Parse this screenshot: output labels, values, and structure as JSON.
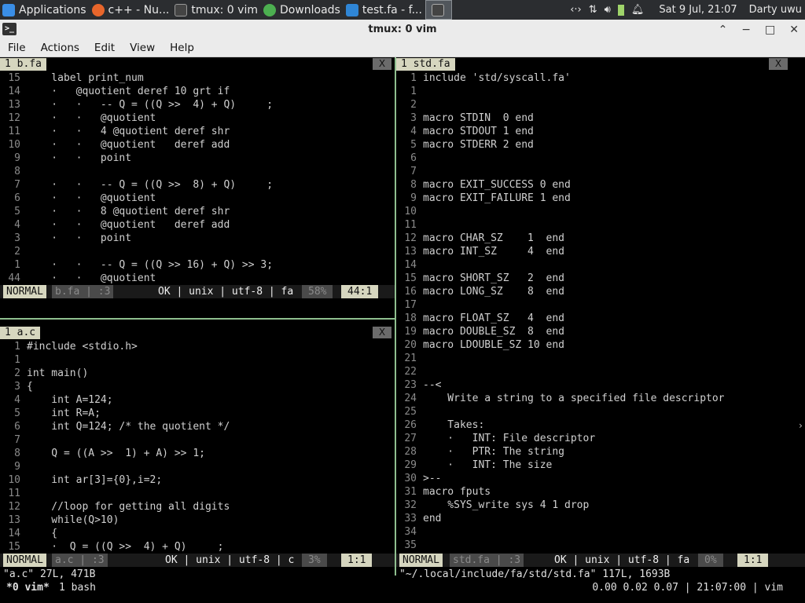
{
  "taskbar": {
    "items": [
      {
        "label": "Applications",
        "icon": "xfce-mouse-icon",
        "color": "#3a8ee6"
      },
      {
        "label": "c++ - Nu...",
        "icon": "firefox-icon",
        "color": "#e8662b"
      },
      {
        "label": "tmux: 0 vim",
        "icon": "terminal-icon",
        "color": "#444444"
      },
      {
        "label": "Downloads",
        "icon": "download-icon",
        "color": "#4caf50"
      },
      {
        "label": "test.fa - f...",
        "icon": "vscode-icon",
        "color": "#2f86d6"
      },
      {
        "label": "",
        "icon": "terminal-icon",
        "color": "#444444"
      }
    ],
    "tray": {
      "clock": "Sat  9 Jul, 21:07",
      "user": "Darty uwu"
    }
  },
  "window": {
    "title": "tmux: 0 vim",
    "icon": "terminal-icon"
  },
  "menu": [
    "File",
    "Actions",
    "Edit",
    "View",
    "Help"
  ],
  "panes": {
    "topleft": {
      "tab": "1  b.fa",
      "close": "X",
      "lines": [
        {
          "no": "15",
          "text": "    label print_num"
        },
        {
          "no": "14",
          "text": "    ·   @quotient deref 10 grt if"
        },
        {
          "no": "13",
          "text": "    ·   ·   -- Q = ((Q >>  4) + Q)     ;"
        },
        {
          "no": "12",
          "text": "    ·   ·   @quotient"
        },
        {
          "no": "11",
          "text": "    ·   ·   4 @quotient deref shr"
        },
        {
          "no": "10",
          "text": "    ·   ·   @quotient   deref add"
        },
        {
          "no": "9",
          "text": "    ·   ·   point"
        },
        {
          "no": "8",
          "text": ""
        },
        {
          "no": "7",
          "text": "    ·   ·   -- Q = ((Q >>  8) + Q)     ;"
        },
        {
          "no": "6",
          "text": "    ·   ·   @quotient"
        },
        {
          "no": "5",
          "text": "    ·   ·   8 @quotient deref shr"
        },
        {
          "no": "4",
          "text": "    ·   ·   @quotient   deref add"
        },
        {
          "no": "3",
          "text": "    ·   ·   point"
        },
        {
          "no": "2",
          "text": ""
        },
        {
          "no": "1",
          "text": "    ·   ·   -- Q = ((Q >> 16) + Q) >> 3;"
        },
        {
          "no": "44",
          "text": "    ·   ·   @quotient"
        }
      ],
      "status": {
        "mode": "NORMAL",
        "file": "b.fa  | :3",
        "info": "OK | unix | utf-8 | fa",
        "pct": "58%",
        "pos": "44:1"
      }
    },
    "bottomleft": {
      "tab": "1  a.c",
      "close": "X",
      "lines": [
        {
          "no": "1",
          "text": "#include <stdio.h>"
        },
        {
          "no": "1",
          "text": ""
        },
        {
          "no": "2",
          "text": "int main()"
        },
        {
          "no": "3",
          "text": "{"
        },
        {
          "no": "4",
          "text": "    int A=124;"
        },
        {
          "no": "5",
          "text": "    int R=A;"
        },
        {
          "no": "6",
          "text": "    int Q=124; /* the quotient */"
        },
        {
          "no": "7",
          "text": ""
        },
        {
          "no": "8",
          "text": "    Q = ((A >>  1) + A) >> 1;"
        },
        {
          "no": "9",
          "text": ""
        },
        {
          "no": "10",
          "text": "    int ar[3]={0},i=2;"
        },
        {
          "no": "11",
          "text": ""
        },
        {
          "no": "12",
          "text": "    //loop for getting all digits"
        },
        {
          "no": "13",
          "text": "    while(Q>10)"
        },
        {
          "no": "14",
          "text": "    {"
        },
        {
          "no": "15",
          "text": "    ·  Q = ((Q >>  4) + Q)     ;"
        }
      ],
      "status": {
        "mode": "NORMAL",
        "file": "a.c  | :3",
        "info": "OK | unix | utf-8 | c",
        "pct": "3%",
        "pos": "1:1"
      }
    },
    "right": {
      "tab": "1  std.fa",
      "close": "X",
      "lines": [
        {
          "no": "1",
          "text": "include 'std/syscall.fa'"
        },
        {
          "no": "1",
          "text": ""
        },
        {
          "no": "2",
          "text": ""
        },
        {
          "no": "3",
          "text": "macro STDIN  0 end"
        },
        {
          "no": "4",
          "text": "macro STDOUT 1 end"
        },
        {
          "no": "5",
          "text": "macro STDERR 2 end"
        },
        {
          "no": "6",
          "text": ""
        },
        {
          "no": "7",
          "text": ""
        },
        {
          "no": "8",
          "text": "macro EXIT_SUCCESS 0 end"
        },
        {
          "no": "9",
          "text": "macro EXIT_FAILURE 1 end"
        },
        {
          "no": "10",
          "text": ""
        },
        {
          "no": "11",
          "text": ""
        },
        {
          "no": "12",
          "text": "macro CHAR_SZ    1  end"
        },
        {
          "no": "13",
          "text": "macro INT_SZ     4  end"
        },
        {
          "no": "14",
          "text": ""
        },
        {
          "no": "15",
          "text": "macro SHORT_SZ   2  end"
        },
        {
          "no": "16",
          "text": "macro LONG_SZ    8  end"
        },
        {
          "no": "17",
          "text": ""
        },
        {
          "no": "18",
          "text": "macro FLOAT_SZ   4  end"
        },
        {
          "no": "19",
          "text": "macro DOUBLE_SZ  8  end"
        },
        {
          "no": "20",
          "text": "macro LDOUBLE_SZ 10 end"
        },
        {
          "no": "21",
          "text": ""
        },
        {
          "no": "22",
          "text": ""
        },
        {
          "no": "23",
          "text": "--<"
        },
        {
          "no": "24",
          "text": "    Write a string to a specified file descriptor"
        },
        {
          "no": "25",
          "text": ""
        },
        {
          "no": "26",
          "text": "    Takes:"
        },
        {
          "no": "27",
          "text": "    ·   INT: File descriptor"
        },
        {
          "no": "28",
          "text": "    ·   PTR: The string"
        },
        {
          "no": "29",
          "text": "    ·   INT: The size"
        },
        {
          "no": "30",
          "text": ">--"
        },
        {
          "no": "31",
          "text": "macro fputs"
        },
        {
          "no": "32",
          "text": "    %SYS_write sys 4 1 drop"
        },
        {
          "no": "33",
          "text": "end"
        },
        {
          "no": "34",
          "text": ""
        },
        {
          "no": "35",
          "text": ""
        }
      ],
      "status": {
        "mode": "NORMAL",
        "file": "std.fa  | :3",
        "info": "OK | unix | utf-8 | fa",
        "pct": "0%",
        "pos": "1:1"
      }
    }
  },
  "cmdline": {
    "left": "\"a.c\" 27L, 471B",
    "right": "\"~/.local/include/fa/std/std.fa\" 117L, 1693B"
  },
  "tmux": {
    "window": "*0 vim*",
    "window2": "1 bash",
    "right": "0.00 0.02 0.07 | 21:07:00 | vim"
  }
}
